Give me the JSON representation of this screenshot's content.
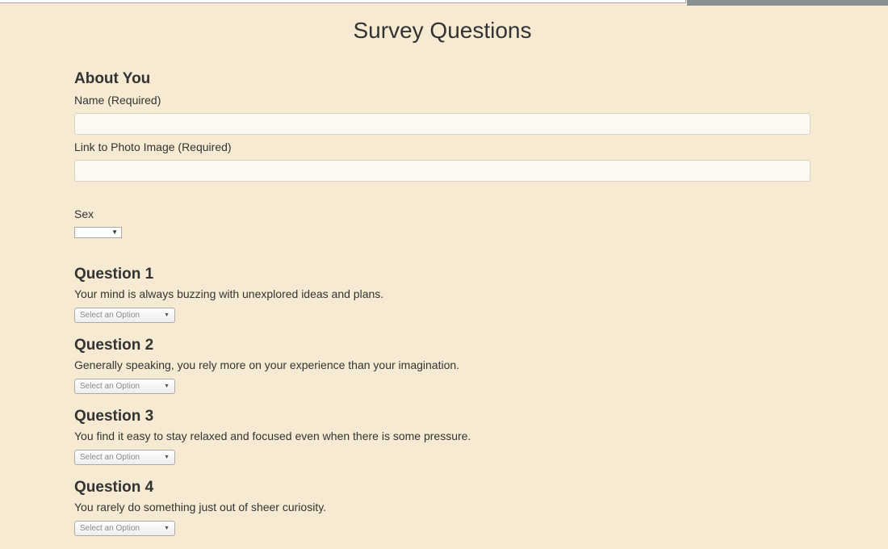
{
  "page": {
    "title": "Survey Questions"
  },
  "about": {
    "heading": "About You",
    "name_label": "Name (Required)",
    "name_value": "",
    "photo_label": "Link to Photo Image (Required)",
    "photo_value": "",
    "sex_label": "Sex",
    "sex_value": ""
  },
  "questions": [
    {
      "heading": "Question 1",
      "text": "Your mind is always buzzing with unexplored ideas and plans.",
      "select_placeholder": "Select an Option"
    },
    {
      "heading": "Question 2",
      "text": "Generally speaking, you rely more on your experience than your imagination.",
      "select_placeholder": "Select an Option"
    },
    {
      "heading": "Question 3",
      "text": "You find it easy to stay relaxed and focused even when there is some pressure.",
      "select_placeholder": "Select an Option"
    },
    {
      "heading": "Question 4",
      "text": "You rarely do something just out of sheer curiosity.",
      "select_placeholder": "Select an Option"
    }
  ],
  "icons": {
    "dropdown": "chevron-down-icon"
  },
  "colors": {
    "background": "#f6ead3",
    "text": "#333333",
    "input_background": "#fdf9f0"
  }
}
